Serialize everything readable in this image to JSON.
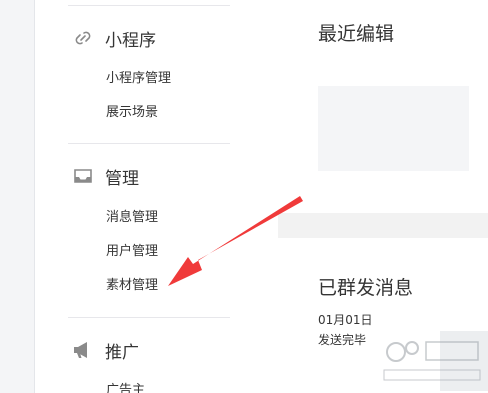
{
  "sidebar": {
    "sections": [
      {
        "icon": "link-icon",
        "label": "小程序",
        "items": [
          "小程序管理",
          "展示场景"
        ]
      },
      {
        "icon": "inbox-icon",
        "label": "管理",
        "items": [
          "消息管理",
          "用户管理",
          "素材管理"
        ]
      },
      {
        "icon": "megaphone-icon",
        "label": "推广",
        "items": [
          "广告主"
        ]
      }
    ]
  },
  "main": {
    "recent_edits": {
      "title": "最近编辑"
    },
    "sent_messages": {
      "title": "已群发消息",
      "date": "01月01日",
      "status": "发送完毕"
    }
  },
  "annotation": {
    "arrow_color": "#f03a3a",
    "points_to": "素材管理"
  },
  "colors": {
    "text": "#353535",
    "divider": "#e7e7eb",
    "page_bg": "#f2f2f2",
    "card_bg": "#ffffff"
  }
}
